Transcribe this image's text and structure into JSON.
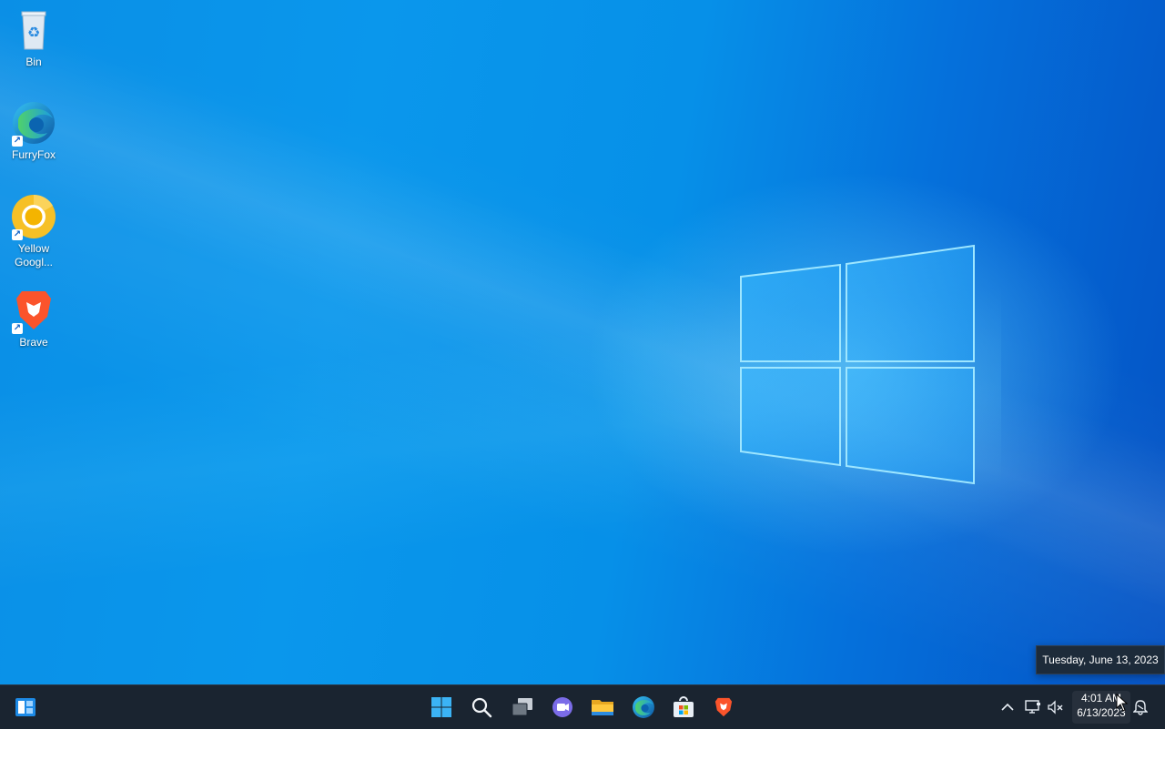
{
  "desktop": {
    "icons": [
      {
        "label": "Bin"
      },
      {
        "label": "FurryFox"
      },
      {
        "label": "Yellow Googl..."
      },
      {
        "label": "Brave"
      }
    ]
  },
  "tooltip": {
    "text": "Tuesday, June 13, 2023"
  },
  "taskbar": {
    "apps": [
      "start-icon",
      "search-icon",
      "task-view-icon",
      "chat-icon",
      "file-explorer-icon",
      "edge-icon",
      "store-icon",
      "brave-icon"
    ],
    "clock": {
      "time": "4:01 AM",
      "date": "6/13/2023"
    }
  },
  "colors": {
    "taskbar": "#1a2430",
    "desktop_accent": "#0a8fe6"
  }
}
